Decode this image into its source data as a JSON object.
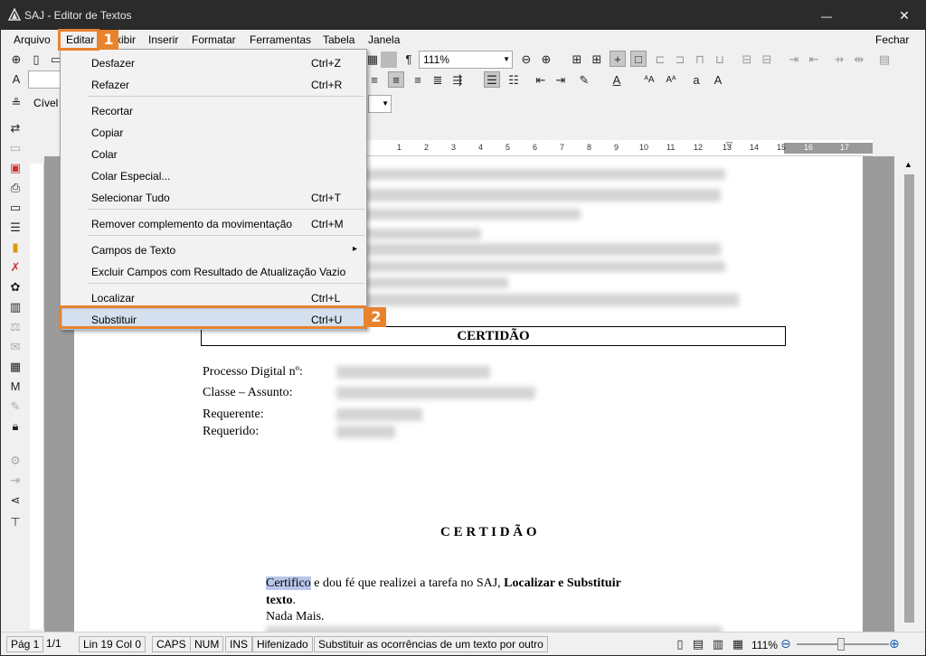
{
  "window": {
    "title": "SAJ - Editor de Textos",
    "close_glyph": "✕",
    "min_glyph": "—"
  },
  "menubar": {
    "items": [
      {
        "label": "Arquivo"
      },
      {
        "label": "Editar"
      },
      {
        "label": "Exibir"
      },
      {
        "label": "Inserir"
      },
      {
        "label": "Formatar"
      },
      {
        "label": "Ferramentas"
      },
      {
        "label": "Tabela"
      },
      {
        "label": "Janela"
      }
    ],
    "close_label": "Fechar"
  },
  "toolbar": {
    "zoom_value": "111%",
    "style_combo_value": "Cível",
    "pilcrow": "¶"
  },
  "edit_menu": {
    "items": [
      {
        "label": "Desfazer",
        "shortcut": "Ctrl+Z"
      },
      {
        "label": "Refazer",
        "shortcut": "Ctrl+R"
      },
      {
        "label": "Recortar",
        "shortcut": ""
      },
      {
        "label": "Copiar",
        "shortcut": ""
      },
      {
        "label": "Colar",
        "shortcut": ""
      },
      {
        "label": "Colar Especial...",
        "shortcut": ""
      },
      {
        "label": "Selecionar Tudo",
        "shortcut": "Ctrl+T"
      },
      {
        "label": "Remover complemento da movimentação",
        "shortcut": "Ctrl+M"
      },
      {
        "label": "Campos de Texto",
        "shortcut": "▸"
      },
      {
        "label": "Excluir Campos com Resultado de Atualização Vazio",
        "shortcut": ""
      },
      {
        "label": "Localizar",
        "shortcut": "Ctrl+L"
      },
      {
        "label": "Substituir",
        "shortcut": "Ctrl+U"
      }
    ]
  },
  "callouts": {
    "one": "1",
    "two": "2"
  },
  "ruler": {
    "ticks": [
      "1",
      "2",
      "3",
      "4",
      "5",
      "6",
      "7",
      "8",
      "9",
      "10",
      "11",
      "12",
      "13",
      "14",
      "15",
      "16",
      "17"
    ]
  },
  "document": {
    "header_box_title": "CERTIDÃO",
    "fields": [
      {
        "label": "Processo Digital nº:"
      },
      {
        "label": "Classe – Assunto:"
      },
      {
        "label": "Requerente:"
      },
      {
        "label": "Requerido:"
      }
    ],
    "body_title": "C E R T I D Ã O",
    "paragraph_highlight": "Certifico",
    "paragraph_rest": " e dou fé que realizei a tarefa no SAJ, ",
    "paragraph_bold": "Localizar e Substituir",
    "paragraph_bold_line2": "texto",
    "paragraph_end": ".",
    "line_nada": "Nada Mais."
  },
  "statusbar": {
    "page": "Pág 1",
    "pages": "1/1",
    "position": "Lin 19  Col 0",
    "caps": "CAPS",
    "num": "NUM",
    "ins": "INS",
    "hyphen": "Hifenizado",
    "message": "Substituir as ocorrências de um texto por outro",
    "zoom": "111%"
  }
}
